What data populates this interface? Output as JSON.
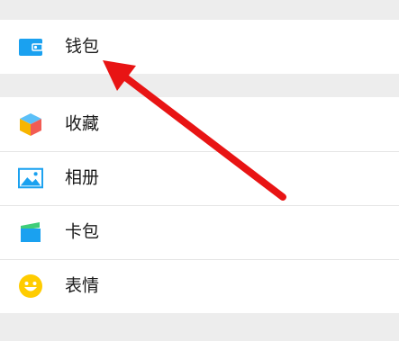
{
  "sections": [
    {
      "items": [
        {
          "label": "钱包",
          "icon": "wallet-icon",
          "icon_color": "#1aa1f0"
        }
      ]
    },
    {
      "items": [
        {
          "label": "收藏",
          "icon": "favorites-cube-icon",
          "icon_colors": [
            "#5bc0f8",
            "#f7b500",
            "#f25c54"
          ]
        },
        {
          "label": "相册",
          "icon": "album-image-icon",
          "icon_color": "#1aa1f0"
        },
        {
          "label": "卡包",
          "icon": "card-wallet-icon",
          "icon_colors": [
            "#1aa1f0",
            "#3fcd7a"
          ]
        },
        {
          "label": "表情",
          "icon": "smiley-icon",
          "icon_color": "#ffcc00"
        }
      ]
    }
  ],
  "annotation": {
    "type": "red-arrow",
    "color": "#e81414",
    "points_to": "钱包"
  }
}
